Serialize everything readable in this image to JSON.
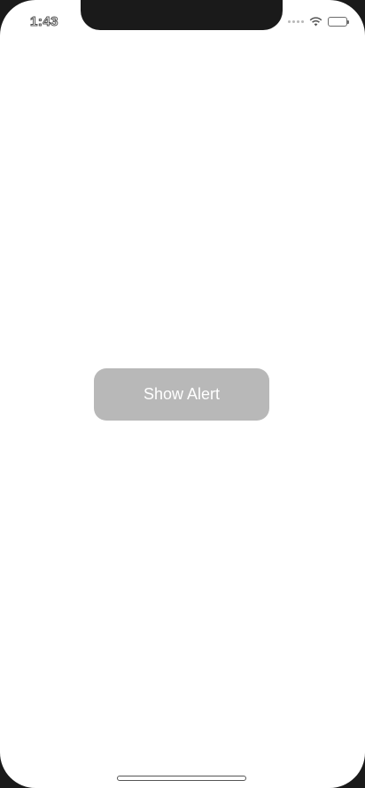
{
  "status_bar": {
    "time": "1:43",
    "icons": [
      "cellular-signal-icon",
      "wifi-icon",
      "battery-icon"
    ]
  },
  "main": {
    "show_alert_button_label": "Show Alert"
  },
  "colors": {
    "button_background": "#b8b8b8",
    "button_text": "#ffffff",
    "screen_background": "#ffffff",
    "device_frame": "#1a1a1a"
  }
}
